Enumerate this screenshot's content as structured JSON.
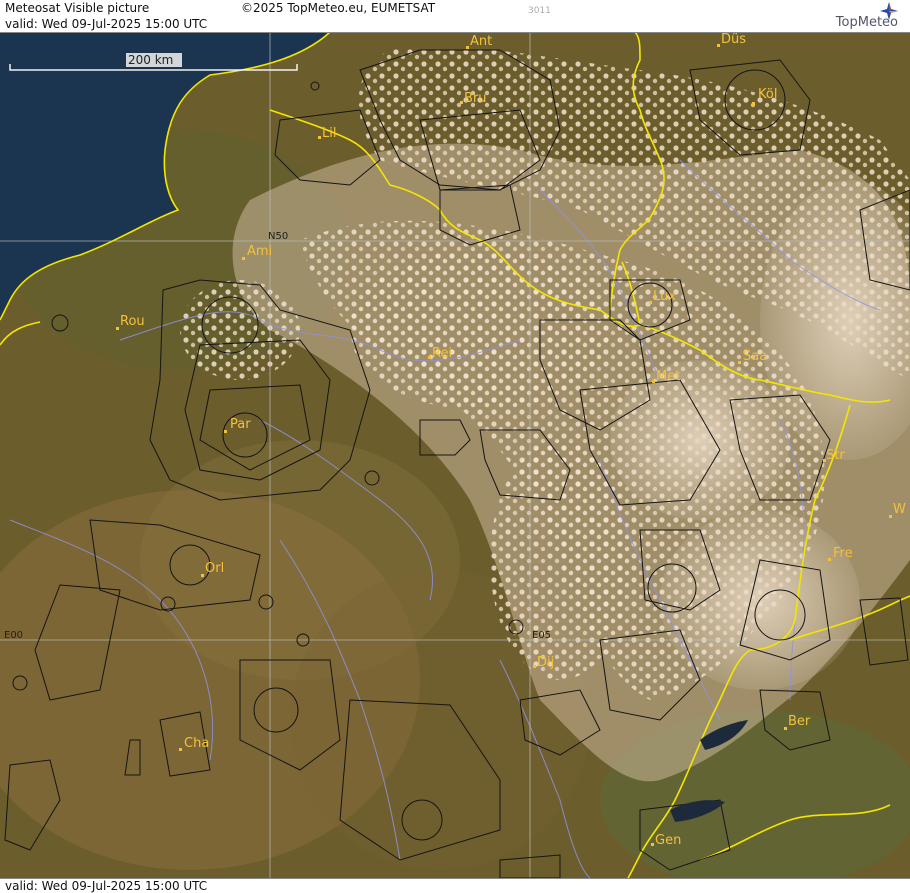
{
  "header": {
    "title": "Meteosat Visible picture",
    "valid_top": "valid:  Wed  09-Jul-2025  15:00 UTC",
    "copyright": "©2025 TopMeteo.eu, EUMETSAT",
    "code": "3011",
    "logo": "TopMeteo"
  },
  "footer": {
    "valid_bottom": "valid:  Wed  09-Jul-2025  15:00 UTC"
  },
  "scale": {
    "label": "200 km"
  },
  "grid_labels": {
    "lat": "N50",
    "lon0": "E00",
    "lon5": "E05"
  },
  "cities": {
    "ant": "Ant",
    "dus": "Düs",
    "bru": "Bru",
    "kol": "Köl",
    "lil": "Lil",
    "ami": "Ami",
    "rou": "Rou",
    "rei": "Rei",
    "lux": "Lux",
    "saa": "Saa",
    "met": "Met",
    "par": "Par",
    "str": "Str",
    "w": "W",
    "fre": "Fre",
    "orl": "Orl",
    "dij": "Dij",
    "ber": "Ber",
    "cha": "Cha",
    "gen": "Gen"
  },
  "colors": {
    "sea": "#1b3550",
    "land": "#6b5d2c",
    "cloud": "#e9d6c1",
    "border": "#f3e600",
    "city_label": "#f4c23a",
    "airspace": "#151515",
    "river": "#8f93e0",
    "grid": "#bbbbbb"
  }
}
